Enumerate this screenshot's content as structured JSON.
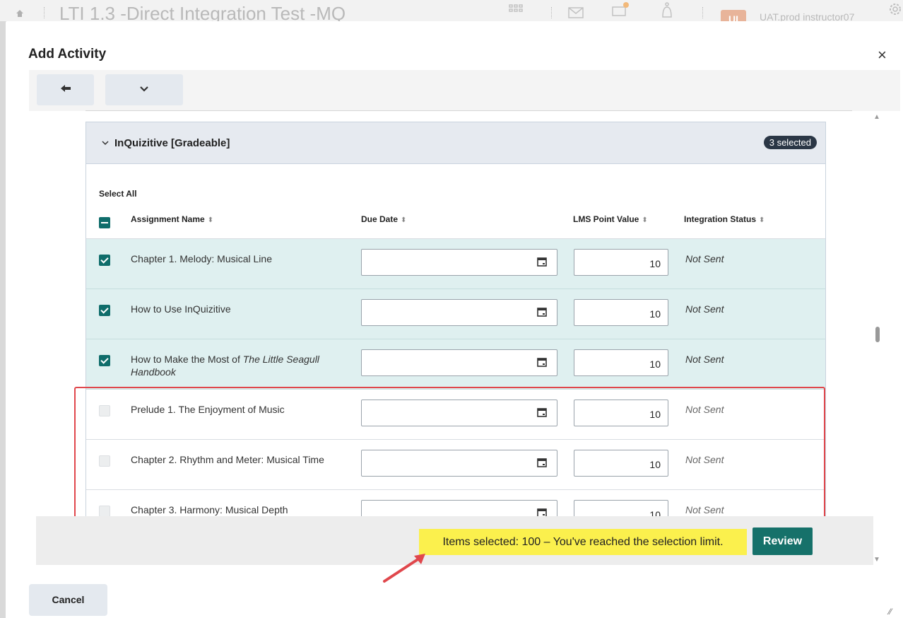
{
  "background": {
    "page_title": "LTI 1.3 -Direct Integration Test -MQ",
    "user_initials": "UI",
    "user_name": "UAT.prod instructor07"
  },
  "modal": {
    "title": "Add Activity",
    "close_glyph": "×"
  },
  "toolbar": {
    "back_icon": "arrow-left-icon",
    "chevron_icon": "chevron-down-icon"
  },
  "section": {
    "title": "InQuizitive [Gradeable]",
    "selected_badge": "3 selected",
    "select_all": "Select All",
    "columns": [
      "Assignment Name",
      "Due Date",
      "LMS Point Value",
      "Integration Status"
    ],
    "rows": [
      {
        "name": "Chapter 1. Melody: Musical Line",
        "name_italic": "",
        "name_tail": "",
        "due": "",
        "points": "10",
        "status": "Not Sent",
        "checked": true
      },
      {
        "name": "How to Use InQuizitive",
        "name_italic": "",
        "name_tail": "",
        "due": "",
        "points": "10",
        "status": "Not Sent",
        "checked": true
      },
      {
        "name": "How to Make the Most of ",
        "name_italic": "The Little Seagull Handbook",
        "name_tail": "",
        "due": "",
        "points": "10",
        "status": "Not Sent",
        "checked": true
      },
      {
        "name": "Prelude 1. The Enjoyment of Music",
        "name_italic": "",
        "name_tail": "",
        "due": "",
        "points": "10",
        "status": "Not Sent",
        "checked": false
      },
      {
        "name": "Chapter 2. Rhythm and Meter: Musical Time",
        "name_italic": "",
        "name_tail": "",
        "due": "",
        "points": "10",
        "status": "Not Sent",
        "checked": false
      },
      {
        "name": "Chapter 3. Harmony: Musical Depth",
        "name_italic": "",
        "name_tail": "",
        "due": "",
        "points": "10",
        "status": "Not Sent",
        "checked": false
      }
    ]
  },
  "footer": {
    "selection_message": "Items selected: 100 – You've reached the selection limit.",
    "review_label": "Review",
    "cancel_label": "Cancel"
  },
  "colors": {
    "accent_teal": "#0f6d6b",
    "checked_row_bg": "#dff0f0",
    "highlight_yellow": "#fbf04d",
    "annotation_red": "#e0474c"
  }
}
